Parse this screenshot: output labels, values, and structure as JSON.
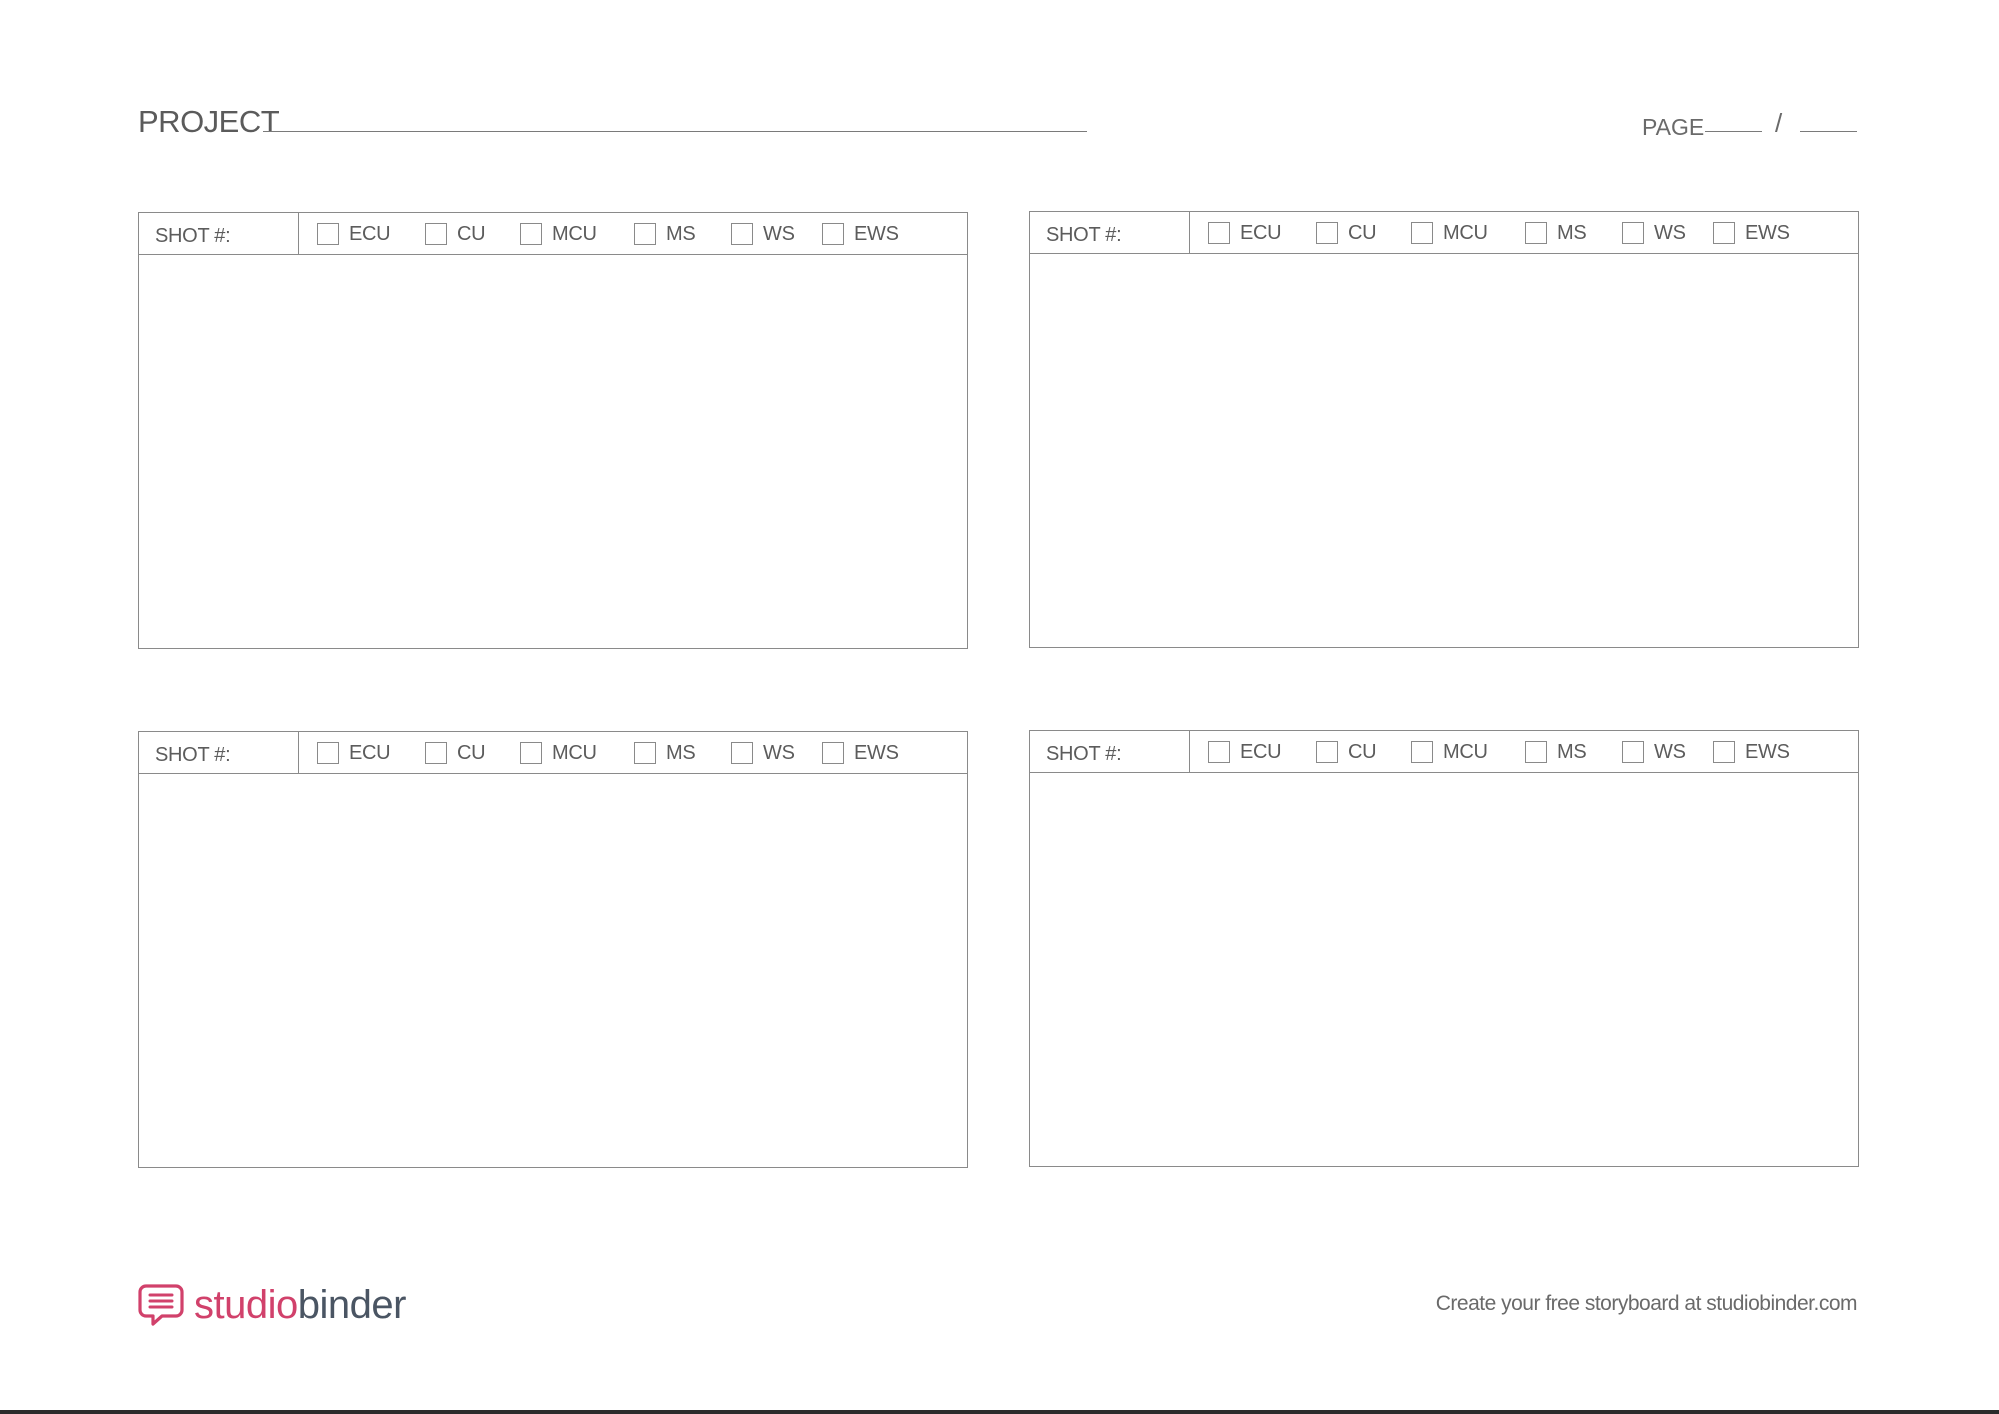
{
  "header": {
    "project_label": "PROJECT",
    "page_label": "PAGE",
    "page_separator": "/"
  },
  "panels": [
    {
      "shot_label": "SHOT #:",
      "options": [
        "ECU",
        "CU",
        "MCU",
        "MS",
        "WS",
        "EWS"
      ]
    },
    {
      "shot_label": "SHOT #:",
      "options": [
        "ECU",
        "CU",
        "MCU",
        "MS",
        "WS",
        "EWS"
      ]
    },
    {
      "shot_label": "SHOT #:",
      "options": [
        "ECU",
        "CU",
        "MCU",
        "MS",
        "WS",
        "EWS"
      ]
    },
    {
      "shot_label": "SHOT #:",
      "options": [
        "ECU",
        "CU",
        "MCU",
        "MS",
        "WS",
        "EWS"
      ]
    }
  ],
  "footer": {
    "logo_studio": "studio",
    "logo_binder": "binder",
    "logo_icon": "speech-bubble-icon",
    "note": "Create your free storyboard at studiobinder.com"
  },
  "colors": {
    "brand_pink": "#d1416b",
    "brand_dark": "#4a5563",
    "line_gray": "#8a8a8a"
  }
}
